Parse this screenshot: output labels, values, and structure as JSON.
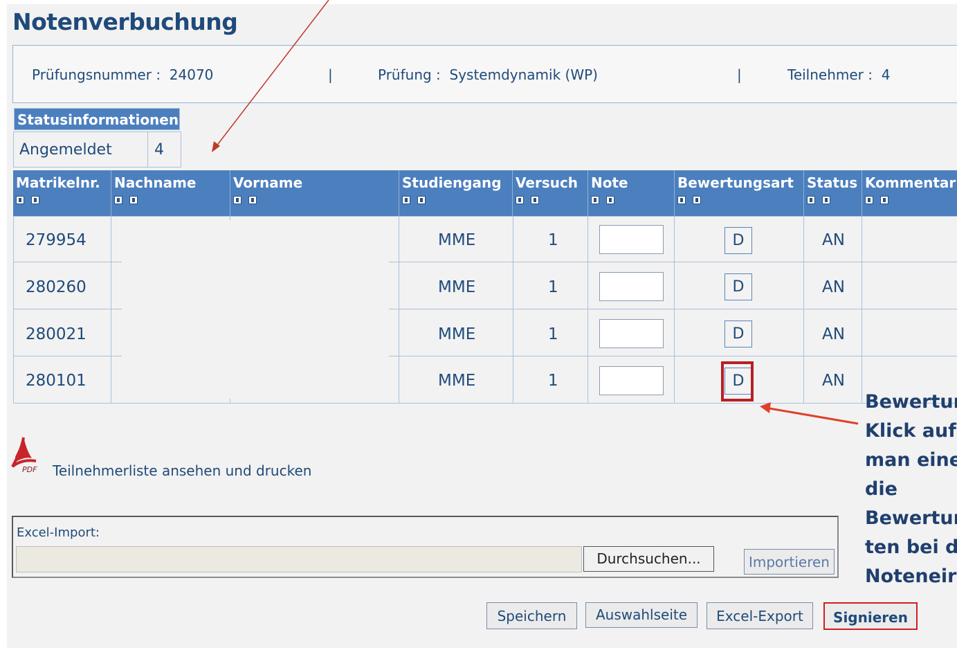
{
  "title": "Notenverbuchung",
  "info": {
    "pruefungsnummer": "Prüfungsnummer :  24070",
    "sep1": "|",
    "pruefung": "Prüfung :  Systemdynamik (WP)",
    "sep2": "|",
    "teilnehmer": "Teilnehmer :  4"
  },
  "status": {
    "header": "Statusinformationen",
    "label": "Angemeldet",
    "count": "4"
  },
  "columns": [
    "Matrikelnr.",
    "Nachname",
    "Vorname",
    "Studiengang",
    "Versuch",
    "Note",
    "Bewertungsart",
    "Status",
    "Kommentar"
  ],
  "rows": [
    {
      "matrikel": "279954",
      "studiengang": "MME",
      "versuch": "1",
      "bewertung": "D",
      "status": "AN"
    },
    {
      "matrikel": "280260",
      "studiengang": "MME",
      "versuch": "1",
      "bewertung": "D",
      "status": "AN"
    },
    {
      "matrikel": "280021",
      "studiengang": "MME",
      "versuch": "1",
      "bewertung": "D",
      "status": "AN"
    },
    {
      "matrikel": "280101",
      "studiengang": "MME",
      "versuch": "1",
      "bewertung": "D",
      "status": "AN"
    }
  ],
  "pdf": {
    "icon": "pdf-icon",
    "label": "Teilnehmerliste ansehen und drucken"
  },
  "excel_import": {
    "label": "Excel-Import:",
    "browse": "Durchsuchen...",
    "import": "Importieren"
  },
  "actions": {
    "save": "Speichern",
    "selection": "Auswahlseite",
    "export": "Excel-Export",
    "sign": "Signieren"
  },
  "annotation": {
    "text": "Bewertun\nKlick auf\nman eine\ndie\nBewertun\nten bei d\nNoteneir"
  },
  "colors": {
    "header_blue": "#4c7fbe",
    "text_blue": "#1f4a7a",
    "highlight_red": "#b71f23"
  }
}
